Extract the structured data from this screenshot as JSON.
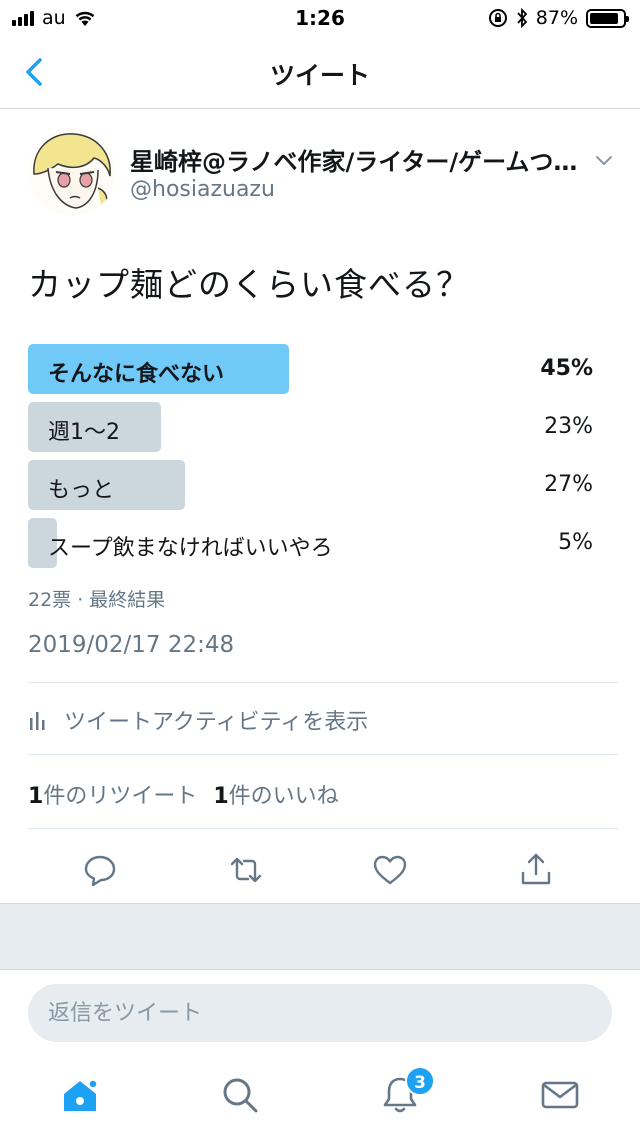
{
  "status_bar": {
    "carrier": "au",
    "time": "1:26",
    "battery_pct": "87%",
    "battery_level": 0.87
  },
  "header": {
    "title": "ツイート",
    "back_icon": "chevron-left-icon"
  },
  "tweet": {
    "author_name": "星崎梓@ラノベ作家/ライター/ゲームつ…",
    "author_handle": "@hosiazuazu",
    "text": "カップ麺どのくらい食べる？",
    "poll": {
      "options": [
        {
          "label": "そんなに食べない",
          "percent": "45%",
          "value": 45,
          "winner": true
        },
        {
          "label": "週1〜2",
          "percent": "23%",
          "value": 23,
          "winner": false
        },
        {
          "label": "もっと",
          "percent": "27%",
          "value": 27,
          "winner": false
        },
        {
          "label": "スープ飲まなければいいやろ",
          "percent": "5%",
          "value": 5,
          "winner": false
        }
      ],
      "meta": "22票 · 最終結果"
    },
    "timestamp": "2019/02/17 22:48",
    "activity_label": "ツイートアクティビティを表示",
    "retweet_count": "1",
    "retweet_label": "件のリツイート",
    "like_count": "1",
    "like_label": "件のいいね"
  },
  "reply": {
    "placeholder": "返信をツイート"
  },
  "tabs": {
    "notifications_badge": "3"
  },
  "colors": {
    "accent": "#1da1f2",
    "poll_winner": "#71c9f8",
    "poll_other": "#ccd6dd",
    "secondary_text": "#657786"
  }
}
